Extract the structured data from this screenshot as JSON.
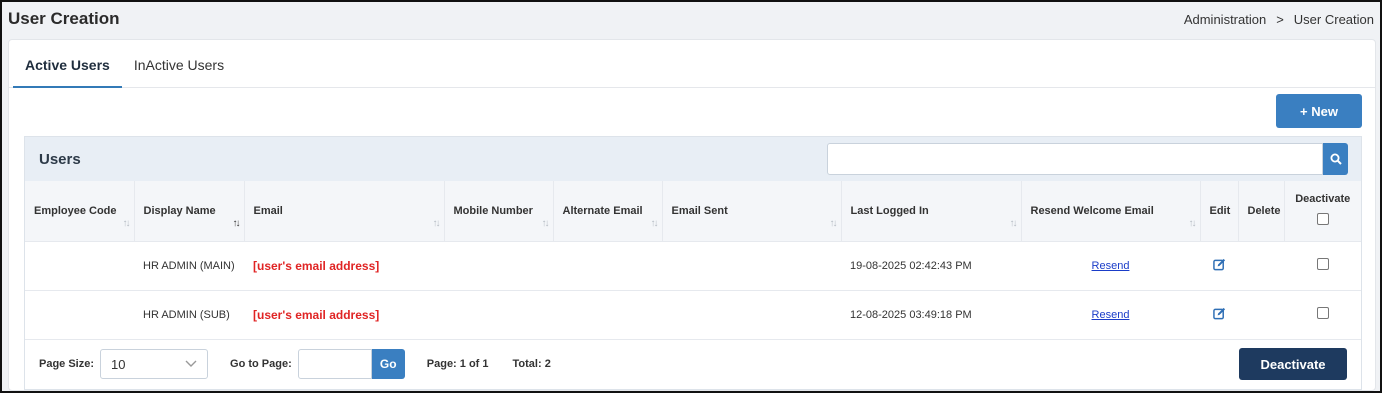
{
  "header": {
    "title": "User Creation",
    "breadcrumb": [
      "Administration",
      ">",
      "User Creation"
    ]
  },
  "tabs": [
    {
      "label": "Active Users",
      "active": true
    },
    {
      "label": "InActive Users",
      "active": false
    }
  ],
  "new_button": "+ New",
  "panel": {
    "title": "Users",
    "search_value": ""
  },
  "table": {
    "columns": [
      "Employee Code",
      "Display Name",
      "Email",
      "Mobile Number",
      "Alternate Email",
      "Email Sent",
      "Last Logged In",
      "Resend Welcome Email",
      "Edit",
      "Delete",
      "Deactivate"
    ],
    "rows": [
      {
        "employee_code": "",
        "display_name": "HR ADMIN (MAIN)",
        "email": "[user's email address]",
        "mobile": "",
        "alternate_email": "",
        "email_sent": "",
        "last_logged_in": "19-08-2025 02:42:43 PM",
        "resend": "Resend"
      },
      {
        "employee_code": "",
        "display_name": "HR ADMIN (SUB)",
        "email": "[user's email address]",
        "mobile": "",
        "alternate_email": "",
        "email_sent": "",
        "last_logged_in": "12-08-2025 03:49:18 PM",
        "resend": "Resend"
      }
    ]
  },
  "footer": {
    "page_size_label": "Page Size:",
    "page_size_value": "10",
    "goto_label": "Go to Page:",
    "go_button": "Go",
    "page_info": "Page: 1 of 1",
    "total": "Total: 2",
    "deactivate_button": "Deactivate"
  },
  "colors": {
    "primary": "#3a7fc1",
    "dark_button": "#1e3a5f",
    "email_red": "#e02424",
    "link": "#1a3cc8"
  }
}
